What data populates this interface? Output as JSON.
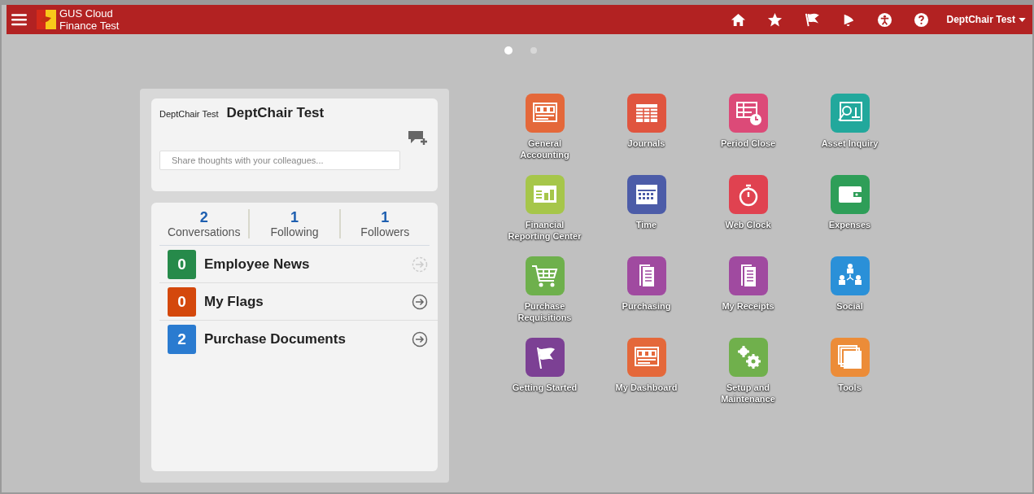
{
  "header": {
    "brand_line_1": "GUS Cloud",
    "brand_line_2": "Finance Test",
    "user": "DeptChair Test"
  },
  "pager": [
    {
      "selected": true
    },
    {
      "selected": false
    }
  ],
  "profile": {
    "small_name": "DeptChair Test",
    "name": "DeptChair Test",
    "share_placeholder": "Share thoughts with your colleagues..."
  },
  "stats": [
    {
      "count": "2",
      "label": "Conversations"
    },
    {
      "count": "1",
      "label": "Following"
    },
    {
      "count": "1",
      "label": "Followers"
    }
  ],
  "feeds": [
    {
      "count": "0",
      "label": "Employee News",
      "color": "#268a4a",
      "disabled": true
    },
    {
      "count": "0",
      "label": "My Flags",
      "color": "#d4480c",
      "disabled": false
    },
    {
      "count": "2",
      "label": "Purchase Documents",
      "color": "#2a7bd0",
      "disabled": false
    }
  ],
  "apps": [
    {
      "label": "General Accounting",
      "kind": "dashboard",
      "color": "#e4683a"
    },
    {
      "label": "Journals",
      "kind": "table",
      "color": "#e0553f"
    },
    {
      "label": "Period Close",
      "kind": "table-clock",
      "color": "#dc4a78"
    },
    {
      "label": "Asset Inquiry",
      "kind": "magnifier",
      "color": "#22a89c"
    },
    {
      "label": "Financial Reporting Center",
      "kind": "report",
      "color": "#a6c64a"
    },
    {
      "label": "Time",
      "kind": "calendar",
      "color": "#4c5ca8"
    },
    {
      "label": "Web Clock",
      "kind": "stopwatch",
      "color": "#e04250"
    },
    {
      "label": "Expenses",
      "kind": "wallet",
      "color": "#2e9e58"
    },
    {
      "label": "Purchase Requisitions",
      "kind": "cart",
      "color": "#6eb04c"
    },
    {
      "label": "Purchasing",
      "kind": "document",
      "color": "#a04aa0"
    },
    {
      "label": "My Receipts",
      "kind": "document",
      "color": "#a04aa0"
    },
    {
      "label": "Social",
      "kind": "people",
      "color": "#2a90d8"
    },
    {
      "label": "Getting Started",
      "kind": "flag",
      "color": "#7c4094"
    },
    {
      "label": "My Dashboard",
      "kind": "dashboard",
      "color": "#e4683a"
    },
    {
      "label": "Setup and Maintenance",
      "kind": "gears",
      "color": "#70b04c"
    },
    {
      "label": "Tools",
      "kind": "windows",
      "color": "#ec8c38"
    }
  ]
}
